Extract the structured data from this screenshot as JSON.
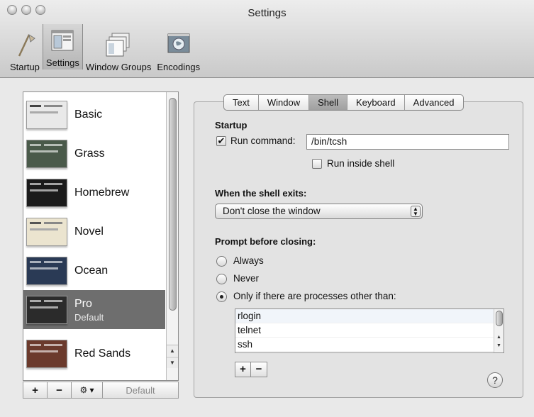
{
  "window": {
    "title": "Settings"
  },
  "toolbar": {
    "items": [
      {
        "label": "Startup",
        "icon": "startup-icon"
      },
      {
        "label": "Settings",
        "icon": "settings-icon",
        "selected": true
      },
      {
        "label": "Window Groups",
        "icon": "window-groups-icon"
      },
      {
        "label": "Encodings",
        "icon": "encodings-icon"
      }
    ]
  },
  "profiles": [
    {
      "name": "Basic",
      "sub": ""
    },
    {
      "name": "Grass",
      "sub": ""
    },
    {
      "name": "Homebrew",
      "sub": ""
    },
    {
      "name": "Novel",
      "sub": ""
    },
    {
      "name": "Ocean",
      "sub": ""
    },
    {
      "name": "Pro",
      "sub": "Default",
      "selected": true
    },
    {
      "name": "Red Sands",
      "sub": ""
    }
  ],
  "list_buttons": {
    "add": "+",
    "remove": "−",
    "gear": "⚙ ▾",
    "default": "Default"
  },
  "tabs": [
    {
      "label": "Text"
    },
    {
      "label": "Window"
    },
    {
      "label": "Shell",
      "selected": true
    },
    {
      "label": "Keyboard"
    },
    {
      "label": "Advanced"
    }
  ],
  "shell": {
    "startup_heading": "Startup",
    "run_command_label": "Run command:",
    "run_command_checked": true,
    "run_command_value": "/bin/tcsh",
    "run_inside_shell_label": "Run inside shell",
    "run_inside_shell_checked": false,
    "exit_heading": "When the shell exits:",
    "exit_value": "Don't close the window",
    "prompt_heading": "Prompt before closing:",
    "prompt_options": [
      {
        "label": "Always",
        "selected": false
      },
      {
        "label": "Never",
        "selected": false
      },
      {
        "label": "Only if there are processes other than:",
        "selected": true
      }
    ],
    "processes": [
      "rlogin",
      "telnet",
      "ssh"
    ],
    "add_label": "+",
    "remove_label": "−",
    "help_label": "?"
  },
  "colors": {
    "thumb_basic": "#e9e9e9",
    "thumb_grass": "#4a5a4a",
    "thumb_homebrew": "#1b1b1b",
    "thumb_novel": "#ebe4cf",
    "thumb_ocean": "#2a3a55",
    "thumb_pro": "#2b2b2b",
    "thumb_redsands": "#6b3a2c"
  }
}
